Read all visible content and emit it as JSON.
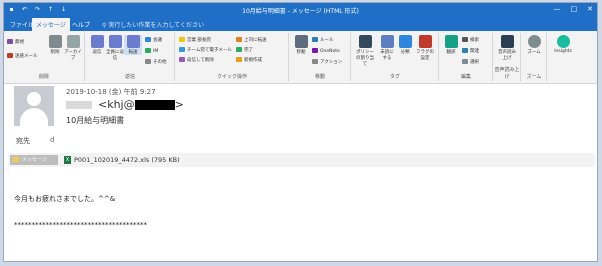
{
  "titlebar": {
    "title": "10月給与明細書 - メッセージ (HTML 形式)",
    "minimize": "—",
    "maximize": "□",
    "close": "✕"
  },
  "tabs": {
    "file": "ファイル",
    "message": "メッセージ",
    "help": "ヘルプ",
    "tell_me": "実行したい作業を入力してください"
  },
  "ribbon": {
    "delete_group": {
      "label": "削除",
      "ignore": "無視",
      "junk": "迷惑メール",
      "delete": "削除",
      "archive": "アーカイブ"
    },
    "respond_group": {
      "label": "返信",
      "reply": "返信",
      "reply_all": "全員に返信",
      "forward": "転送",
      "meeting": "会議",
      "im": "IM",
      "more": "その他"
    },
    "quick_group": {
      "label": "クイック操作",
      "item1": "営業 部長宛",
      "item2": "チーム宛て電子メール",
      "item3": "返信して削除",
      "item4": "上司に転送",
      "item5": "完了",
      "item6": "新規作成"
    },
    "move_group": {
      "label": "移動",
      "move": "移動",
      "rules": "ルール",
      "onenote": "OneNote",
      "actions": "アクション"
    },
    "tags_group": {
      "label": "タグ",
      "policy": "ポリシーの割り当て",
      "unread": "未読にする",
      "categorize": "分類",
      "followup": "フラグの設定"
    },
    "edit_group": {
      "label": "編集",
      "search": "検索",
      "related": "関連",
      "select": "選択",
      "translate": "翻訳"
    },
    "speech_group": {
      "label": "音声読み上げ",
      "read_aloud": "音声読み上げ"
    },
    "zoom_group": {
      "label": "ズーム",
      "zoom": "ズーム"
    },
    "insights": "Insights"
  },
  "message": {
    "date": "2019-10-18 (金) 午前 9:27",
    "sender_prefix": "<khj@",
    "sender_suffix": ">",
    "subject": "10月給与明細書",
    "to_label": "宛先",
    "to_value": "d",
    "message_chip": "メッセージ",
    "attachment": "P001_102019_4472.xls (795 KB)",
    "body_line1": "今月もお疲れさまでした。^^&",
    "body_line2": "**************************************"
  }
}
